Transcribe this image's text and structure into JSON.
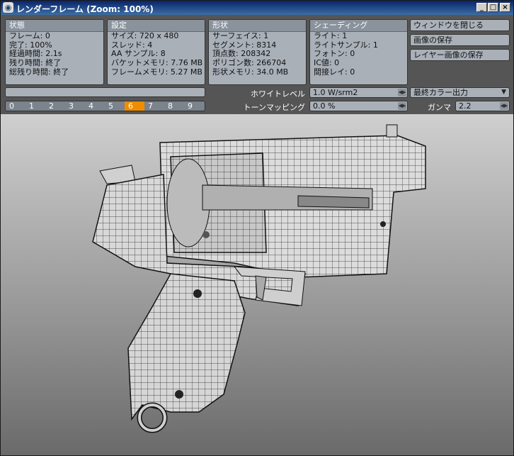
{
  "window": {
    "title": "レンダーフレーム (Zoom: 100%)",
    "min": "_",
    "max": "□",
    "close": "×"
  },
  "status": {
    "header": "状態",
    "rows": [
      "フレーム: 0",
      "完了: 100%",
      "経過時間: 2.1s",
      "残り時間: 終了",
      "総残り時間: 終了"
    ]
  },
  "settings": {
    "header": "設定",
    "rows": [
      "サイズ: 720 x 480",
      "スレッド: 4",
      "AA サンプル: 8",
      "バケットメモリ: 7.76 MB",
      "フレームメモリ: 5.27 MB"
    ]
  },
  "shape": {
    "header": "形状",
    "rows": [
      "サーフェイス: 1",
      "セグメント: 8314",
      "頂点数: 208342",
      "ポリゴン数: 266704",
      "形状メモリ: 34.0 MB"
    ]
  },
  "shading": {
    "header": "シェーディング",
    "rows": [
      "ライト: 1",
      "ライトサンプル: 1",
      "フォトン: 0",
      "IC値: 0",
      "間接レイ: 0"
    ]
  },
  "buttons": {
    "close_window": "ウィンドウを閉じる",
    "save_image": "画像の保存",
    "save_layer": "レイヤー画像の保存"
  },
  "frames": [
    "0",
    "1",
    "2",
    "3",
    "4",
    "5",
    "6",
    "7",
    "8",
    "9"
  ],
  "active_frame": "6",
  "white_level": {
    "label": "ホワイトレベル",
    "value": "1.0 W/srm2"
  },
  "tone_mapping": {
    "label": "トーンマッピング",
    "value": "0.0 %"
  },
  "output": {
    "value": "最終カラー出力"
  },
  "gamma": {
    "label": "ガンマ",
    "value": "2.2"
  },
  "colors": {
    "accent": "#f08c00",
    "panel": "#a9b0b8",
    "titlebar": "#0a246a"
  }
}
